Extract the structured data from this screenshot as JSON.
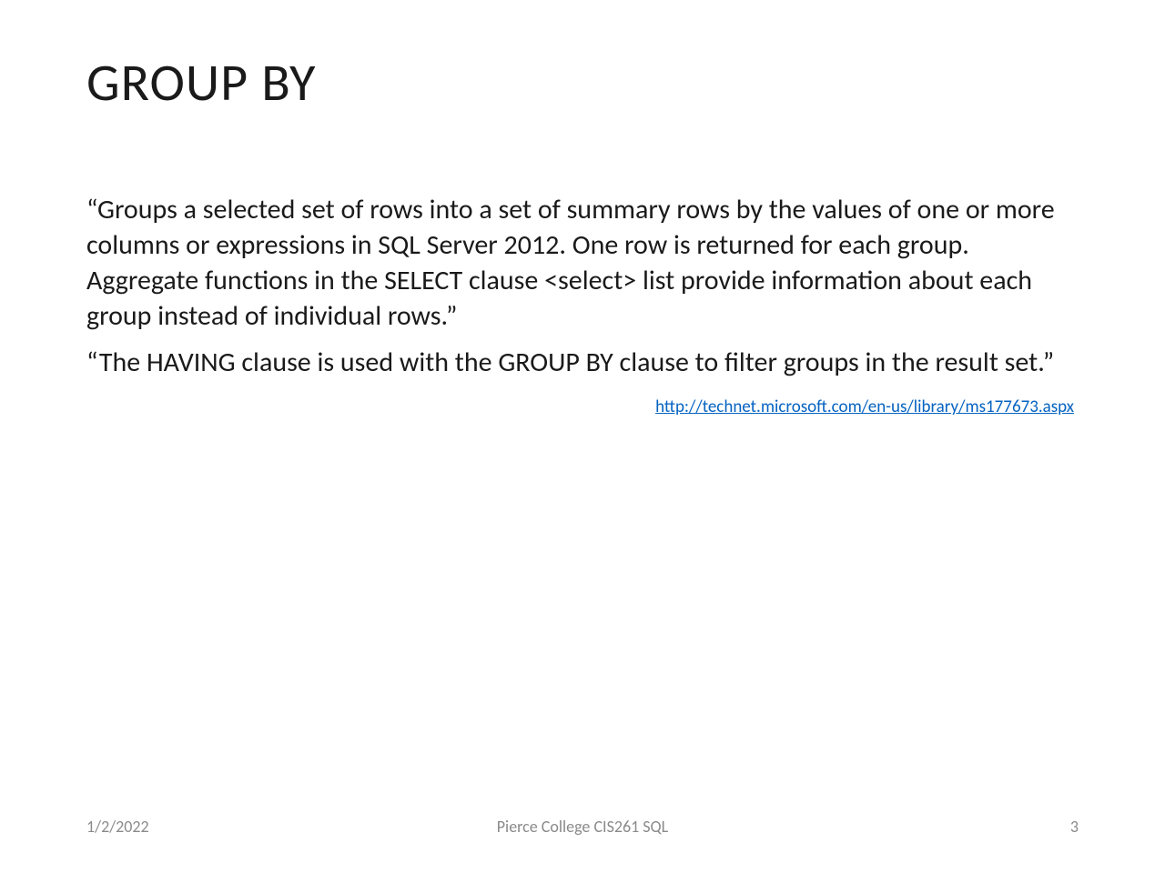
{
  "slide": {
    "title": "GROUP BY",
    "paragraph1": "“Groups a selected set of rows into a set of summary rows by the values of one or more columns or expressions in SQL Server 2012. One row is returned for each group. Aggregate functions in the SELECT clause <select> list provide information about each group instead of individual rows.”",
    "paragraph2": "“The HAVING clause is used with the GROUP BY clause to filter groups in the result set.”",
    "link": "http://technet.microsoft.com/en-us/library/ms177673.aspx"
  },
  "footer": {
    "date": "1/2/2022",
    "center": "Pierce College CIS261 SQL",
    "page": "3"
  }
}
